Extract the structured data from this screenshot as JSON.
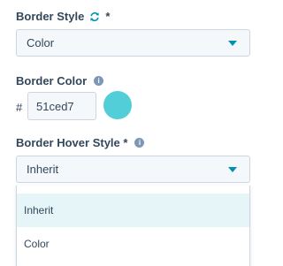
{
  "border_style": {
    "label": "Border Style",
    "required_marker": "*",
    "icon": "sync-icon",
    "value": "Color"
  },
  "border_color": {
    "label": "Border Color",
    "info_icon": "info-icon",
    "hash": "#",
    "value": "51ced7",
    "swatch_color": "#51ced7"
  },
  "border_hover_style": {
    "label": "Border Hover Style *",
    "info_icon": "info-icon",
    "value": "Inherit",
    "options": [
      {
        "label": "Inherit",
        "selected": true
      },
      {
        "label": "Color",
        "selected": false
      }
    ]
  },
  "colors": {
    "accent": "#0091ae",
    "text": "#33475b",
    "info_icon": "#7c98b6",
    "field_bg": "#f5f8fa",
    "field_border": "#cbd6e2",
    "option_selected_bg": "#e5f5f8"
  }
}
